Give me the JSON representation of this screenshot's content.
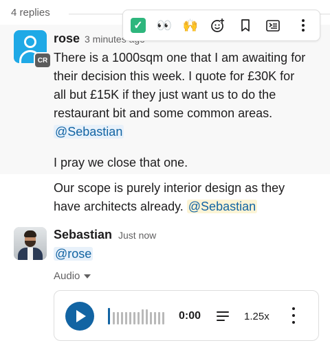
{
  "thread": {
    "replies_label": "4 replies"
  },
  "toolbar": {
    "reactions": [
      {
        "name": "check-mark-icon",
        "glyph": "✓"
      },
      {
        "name": "eyes-icon",
        "glyph": "👀"
      },
      {
        "name": "raised-hands-icon",
        "glyph": "🙌"
      }
    ],
    "actions": [
      {
        "name": "add-reaction-icon"
      },
      {
        "name": "bookmark-icon"
      },
      {
        "name": "reply-in-thread-icon"
      },
      {
        "name": "more-actions-icon"
      }
    ]
  },
  "message1": {
    "author": "rose",
    "timestamp": "3 minutes ago",
    "avatar_badge": "CR",
    "text_lines": [
      "There is a 1000sqm one that I am awaiting for",
      "their decision this week. I quote for £30K for",
      "all but £15K if they just want us to do the",
      "restaurant bit and some common areas."
    ],
    "mention": "@Sebastian",
    "followup": "I pray we close that one."
  },
  "message2": {
    "text_line1": "Our scope is purely interior design as they",
    "text_line2_prefix": "have architects already.",
    "mention": "@Sebastian"
  },
  "message3": {
    "author": "Sebastian",
    "timestamp": "Just now",
    "mention": "@rose",
    "attachment_label": "Audio",
    "audio": {
      "time": "0:00",
      "speed": "1.25x",
      "progress": 0
    }
  },
  "colors": {
    "link": "#1264a3",
    "mention_bg": "#e8f1fa",
    "mention_self_bg": "#fcf4d6",
    "play": "#1264a3",
    "avatar_rose": "#1fa9e6"
  }
}
